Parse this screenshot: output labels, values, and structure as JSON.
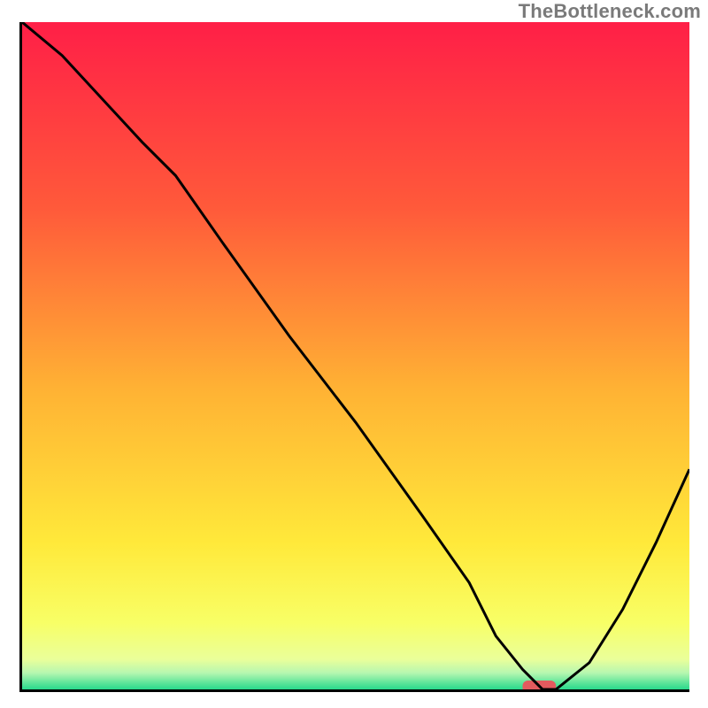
{
  "watermark": "TheBottleneck.com",
  "colors": {
    "axis": "#000000",
    "curve": "#000000",
    "marker": "#e35a5e",
    "gradient_stops": [
      {
        "offset": 0.0,
        "color": "#ff1f47"
      },
      {
        "offset": 0.28,
        "color": "#ff5a3a"
      },
      {
        "offset": 0.55,
        "color": "#ffb234"
      },
      {
        "offset": 0.78,
        "color": "#ffe93a"
      },
      {
        "offset": 0.9,
        "color": "#f8ff66"
      },
      {
        "offset": 0.955,
        "color": "#eaff9a"
      },
      {
        "offset": 0.975,
        "color": "#b7f7b0"
      },
      {
        "offset": 0.99,
        "color": "#5fe59a"
      },
      {
        "offset": 1.0,
        "color": "#28d98c"
      }
    ]
  },
  "chart_data": {
    "type": "line",
    "title": "",
    "xlabel": "",
    "ylabel": "",
    "xlim": [
      0,
      100
    ],
    "ylim": [
      0,
      100
    ],
    "x": [
      0,
      6,
      18,
      23,
      30,
      40,
      50,
      60,
      67,
      71,
      75,
      78,
      80,
      85,
      90,
      95,
      100
    ],
    "values": [
      100,
      95,
      82,
      77,
      67,
      53,
      40,
      26,
      16,
      8,
      3,
      0,
      0,
      4,
      12,
      22,
      33
    ],
    "marker": {
      "x_range": [
        75,
        80
      ],
      "y": 0
    },
    "note": "Values estimated from pixel positions; y is percent of plot height (0 at bottom). Background is a vertical red→green gradient."
  }
}
